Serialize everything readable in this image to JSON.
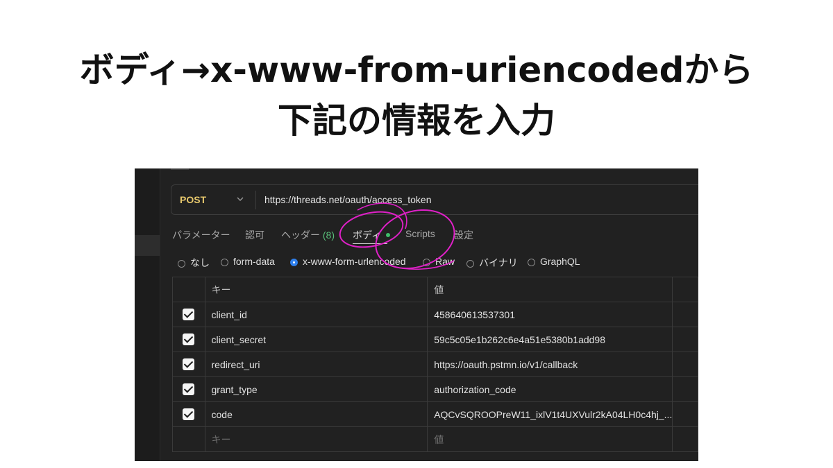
{
  "headline": {
    "line1": "ボディ→x-www-from-uriencodedから",
    "line2": "下記の情報を入力"
  },
  "request": {
    "method": "POST",
    "url": "https://threads.net/oauth/access_token"
  },
  "tabs": [
    {
      "label": "パラメーター"
    },
    {
      "label": "認可"
    },
    {
      "label": "ヘッダー",
      "count": "(8)"
    },
    {
      "label": "ボディ",
      "active": true
    },
    {
      "label": "Scripts"
    },
    {
      "label": "設定"
    }
  ],
  "body_types": [
    {
      "label": "なし"
    },
    {
      "label": "form-data"
    },
    {
      "label": "x-www-form-urlencoded",
      "selected": true
    },
    {
      "label": "Raw"
    },
    {
      "label": "バイナリ"
    },
    {
      "label": "GraphQL"
    }
  ],
  "table": {
    "headers": {
      "key": "キー",
      "value": "値"
    },
    "rows": [
      {
        "key": "client_id",
        "value": "458640613537301"
      },
      {
        "key": "client_secret",
        "value": "59c5c05e1b262c6e4a51e5380b1add98"
      },
      {
        "key": "redirect_uri",
        "value": "https://oauth.pstmn.io/v1/callback"
      },
      {
        "key": "grant_type",
        "value": "authorization_code"
      },
      {
        "key": "code",
        "value": "AQCvSQROOPreW11_ixlV1t4UXVulr2kA04LH0c4hj_..."
      }
    ],
    "new_row": {
      "key_placeholder": "キー",
      "value_placeholder": "値"
    }
  },
  "colors": {
    "panel_bg": "#212121",
    "method": "#e8c96d",
    "count": "#59c07a",
    "active_dot": "#3fbf6a",
    "radio_selected": "#2f80ed",
    "annotation": "#e020c8"
  }
}
